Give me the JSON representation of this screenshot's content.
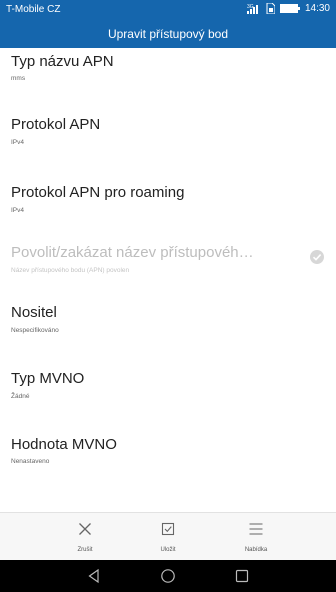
{
  "status": {
    "carrier": "T-Mobile CZ",
    "time": "14:30",
    "icons": [
      "signal-icon",
      "sim-icon",
      "battery-icon"
    ]
  },
  "title": "Upravit přístupový bod",
  "items": [
    {
      "title": "Typ názvu APN",
      "sub": "mms",
      "enabled": true
    },
    {
      "title": "Protokol APN",
      "sub": "IPv4",
      "enabled": true
    },
    {
      "title": "Protokol APN pro roaming",
      "sub": "IPv4",
      "enabled": true
    },
    {
      "title": "Povolit/zakázat název přístupovéh…",
      "sub": "Název přístupového bodu (APN) povolen",
      "enabled": false
    },
    {
      "title": "Nositel",
      "sub": "Nespecifikováno",
      "enabled": true
    },
    {
      "title": "Typ MVNO",
      "sub": "Žádné",
      "enabled": true
    },
    {
      "title": "Hodnota MVNO",
      "sub": "Nenastaveno",
      "enabled": true
    }
  ],
  "bottom": {
    "cancel": "Zrušit",
    "save": "Uložit",
    "menu": "Nabídka"
  },
  "nav": {
    "icons": [
      "back-icon",
      "home-icon",
      "recents-icon"
    ]
  },
  "colors": {
    "accent": "#1566ad",
    "bottom_bar": "#f7f7f7",
    "nav_bar": "#000000"
  }
}
